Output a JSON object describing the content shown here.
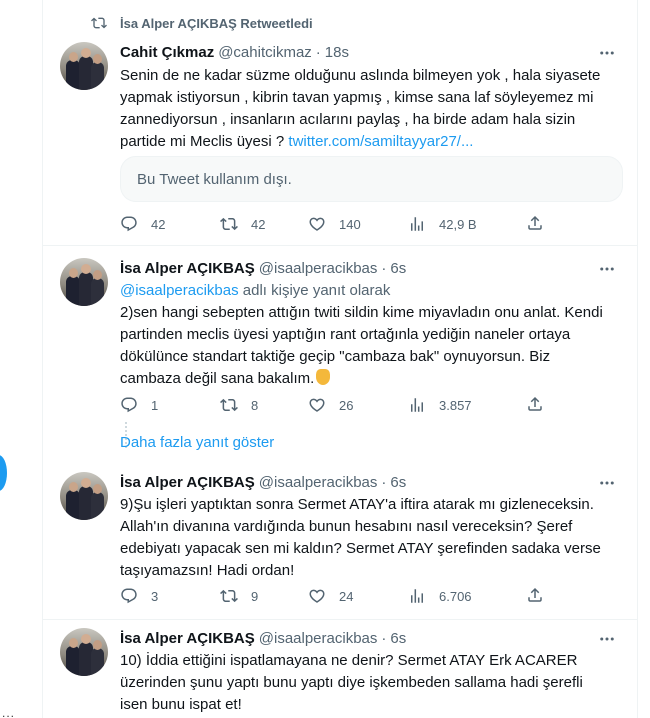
{
  "retweet": {
    "label": "İsa Alper AÇIKBAŞ Retweetledi",
    "name": "Cahit Çıkmaz",
    "handle": "@cahitcikmaz",
    "separator": "·",
    "time": "18s",
    "lines": [
      "Senin de ne kadar süzme olduğunu aslında bilmeyen yok , hala siyasete",
      "yapmak istiyorsun , kibrin tavan yapmış , kimse sana laf söyleyemez mi",
      "zannediyorsun , insanların acılarını paylaş , ha birde adam hala sizin",
      "partide mi Meclis üyesi ? "
    ],
    "link": "twitter.com/samiltayyar27/...",
    "unavailable": "Bu Tweet kullanım dışı.",
    "stats": {
      "replies": "42",
      "retweets": "42",
      "likes": "140",
      "views": "42,9 B"
    }
  },
  "reply1": {
    "name": "İsa Alper AÇIKBAŞ",
    "handle": "@isaalperacikbas",
    "separator": "·",
    "time": "6s",
    "reply_handle": "@isaalperacikbas",
    "reply_suffix": " adlı kişiye yanıt olarak",
    "lines": [
      "2)sen hangi sebepten attığın twiti sildin kime miyavladın onu anlat. Kendi",
      "partinden meclis üyesi yaptığın rant ortağınla yediğin naneler ortaya",
      "dökülünce standart taktiğe geçip \"cambaza bak\" oynuyorsun. Biz",
      "cambaza değil sana bakalım."
    ],
    "stats": {
      "replies": "1",
      "retweets": "8",
      "likes": "26",
      "views": "3.857"
    }
  },
  "show_more": "Daha fazla yanıt göster",
  "reply2": {
    "name": "İsa Alper AÇIKBAŞ",
    "handle": "@isaalperacikbas",
    "separator": "·",
    "time": "6s",
    "lines": [
      "9)Şu işleri yaptıktan sonra Sermet ATAY'a iftira atarak mı gizleneceksin.",
      "Allah'ın divanına vardığında bunun hesabını nasıl vereceksin? Şeref",
      "edebiyatı yapacak sen mi kaldın? Sermet ATAY şerefinden sadaka verse",
      "taşıyamazsın! Hadi ordan!"
    ],
    "stats": {
      "replies": "3",
      "retweets": "9",
      "likes": "24",
      "views": "6.706"
    }
  },
  "reply3": {
    "name": "İsa Alper AÇIKBAŞ",
    "handle": "@isaalperacikbas",
    "separator": "·",
    "time": "6s",
    "lines": [
      "10) İddia ettiğini ispatlamayana ne denir? Sermet ATAY Erk ACARER",
      "üzerinden şunu yaptı bunu yaptı diye işkembeden sallama hadi şerefli",
      "isen bunu ispat et!"
    ]
  },
  "left_dots": "...",
  "colors": {
    "accent": "#1d9bf0",
    "text": "#0f1419",
    "muted": "#536471",
    "border": "#eff3f4"
  }
}
